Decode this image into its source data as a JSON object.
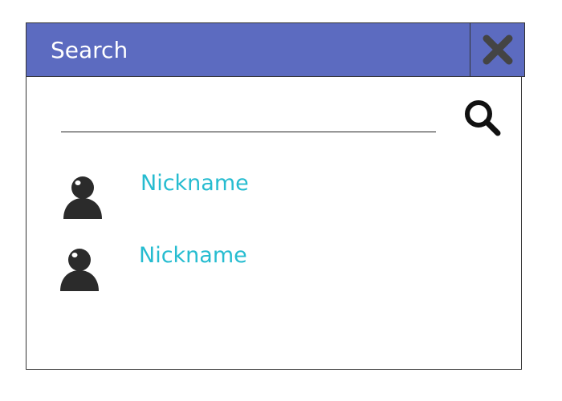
{
  "dialog": {
    "title": "Search",
    "close_icon": "close-icon",
    "title_bar_color": "#5c6bc0"
  },
  "search": {
    "value": "",
    "placeholder": "",
    "icon": "search-icon"
  },
  "results": [
    {
      "nickname": "Nickname",
      "icon": "user-avatar-icon"
    },
    {
      "nickname": "Nickname",
      "icon": "user-avatar-icon"
    }
  ],
  "colors": {
    "accent": "#26bcd0",
    "icon": "#2b2b2b"
  }
}
